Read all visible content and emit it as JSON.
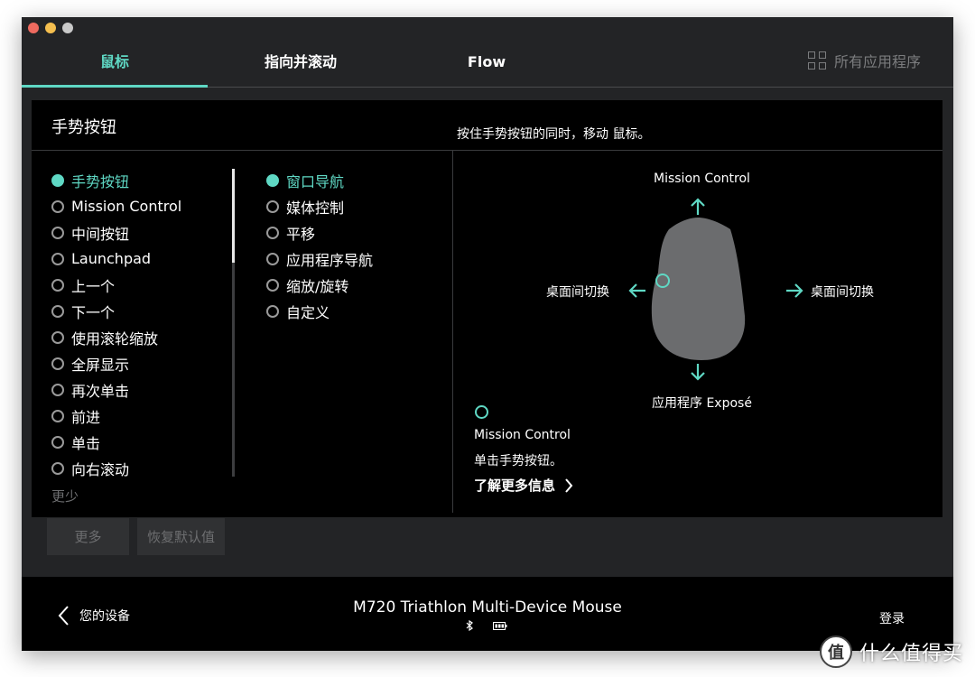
{
  "window": {
    "traffic_lights": [
      {
        "name": "close",
        "color": "#ee6a5f"
      },
      {
        "name": "minimize",
        "color": "#f5bf4f"
      },
      {
        "name": "maximize",
        "color": "#c9c9c9"
      }
    ]
  },
  "tabs": [
    {
      "label": "鼠标",
      "active": true
    },
    {
      "label": "指向并滚动",
      "active": false
    },
    {
      "label": "Flow",
      "active": false
    }
  ],
  "all_apps": {
    "label": "所有应用程序",
    "icon": "grid-icon"
  },
  "panel": {
    "title": "手势按钮",
    "hint": "按住手势按钮的同时，移动 鼠标。"
  },
  "button_list": {
    "items": [
      {
        "label": "手势按钮",
        "selected": true
      },
      {
        "label": "Mission Control",
        "selected": false
      },
      {
        "label": "中间按钮",
        "selected": false
      },
      {
        "label": "Launchpad",
        "selected": false
      },
      {
        "label": "上一个",
        "selected": false
      },
      {
        "label": "下一个",
        "selected": false
      },
      {
        "label": "使用滚轮缩放",
        "selected": false
      },
      {
        "label": "全屏显示",
        "selected": false
      },
      {
        "label": "再次单击",
        "selected": false
      },
      {
        "label": "前进",
        "selected": false
      },
      {
        "label": "单击",
        "selected": false
      },
      {
        "label": "向右滚动",
        "selected": false
      }
    ],
    "less_label": "更少"
  },
  "gesture_list": {
    "items": [
      {
        "label": "窗口导航",
        "selected": true
      },
      {
        "label": "媒体控制",
        "selected": false
      },
      {
        "label": "平移",
        "selected": false
      },
      {
        "label": "应用程序导航",
        "selected": false
      },
      {
        "label": "缩放/旋转",
        "selected": false
      },
      {
        "label": "自定义",
        "selected": false
      }
    ]
  },
  "diagram": {
    "up": "Mission Control",
    "left": "桌面间切换",
    "right": "桌面间切换",
    "down": "应用程序 Exposé"
  },
  "info": {
    "title": "Mission Control",
    "description": "单击手势按钮。",
    "learn_more": "了解更多信息"
  },
  "buttons": {
    "more": "更多",
    "restore_defaults": "恢复默认值"
  },
  "bottom": {
    "back_label": "您的设备",
    "device_name": "M720 Triathlon Multi-Device Mouse",
    "connection_icon": "bluetooth-icon",
    "battery_icon": "battery-icon",
    "login": "登录"
  },
  "watermark": {
    "badge": "值",
    "text": "什么值得买"
  },
  "colors": {
    "accent": "#5fd8c4",
    "window_bg": "#232426",
    "panel_bg": "#000000"
  }
}
